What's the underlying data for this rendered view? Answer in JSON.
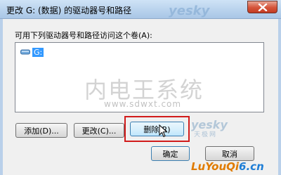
{
  "window": {
    "title": "更改 G: (数据) 的驱动器号和路径",
    "close_icon": "close-icon"
  },
  "dialog": {
    "instruction": "可用下列驱动器号和路径访问这个卷(A):",
    "volume_list": [
      {
        "label": "G:",
        "icon": "drive-icon",
        "selected": true
      }
    ],
    "buttons": {
      "add": "添加(D)...",
      "change": "更改(C)...",
      "remove": "删除(R)",
      "ok": "确定",
      "cancel": "取消"
    }
  },
  "watermarks": {
    "site_cn": "内电王系统",
    "site_url": "www.sdwxt.com",
    "yesky": "yesky",
    "tianji": "天极网",
    "luyouqi_prefix": "LuYouQi",
    "luyouqi_suffix": "6.cn"
  },
  "colors": {
    "selection": "#3399ff",
    "highlight_box": "#d11b1b",
    "title_bar": "#b7d1ec"
  }
}
